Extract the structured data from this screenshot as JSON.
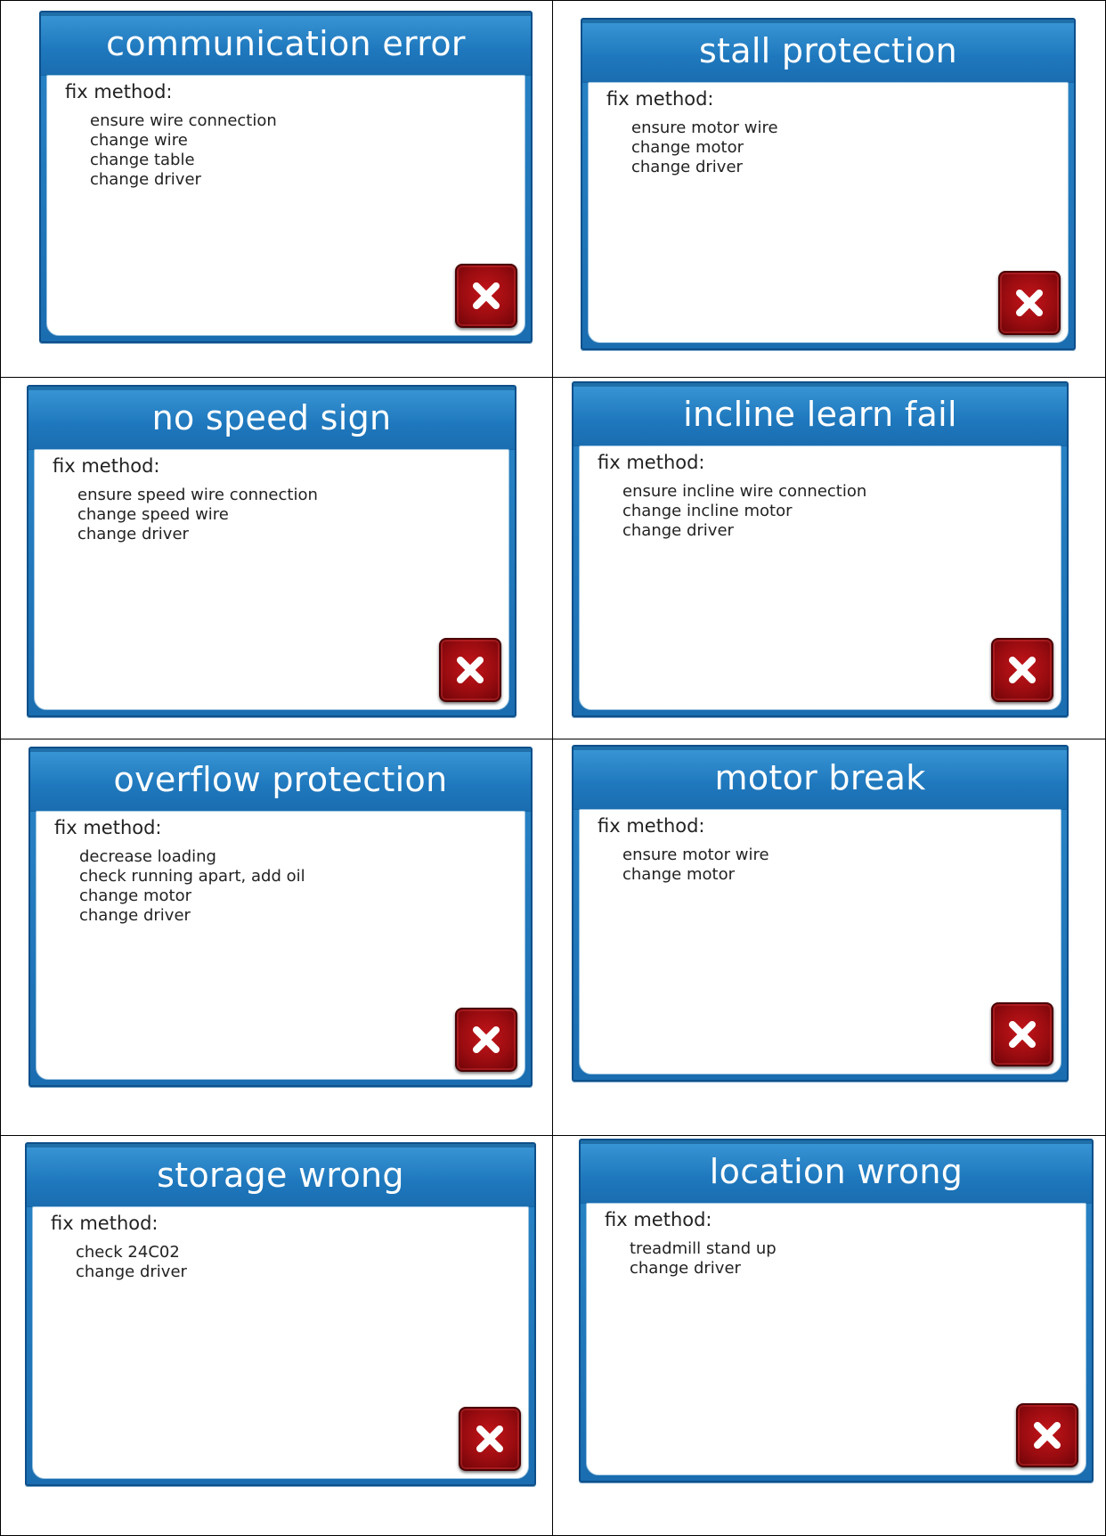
{
  "dialogs": [
    {
      "title": "communication error",
      "fix_label": "fix method:",
      "items": [
        "ensure wire connection",
        "change wire",
        "change table",
        "change driver"
      ]
    },
    {
      "title": "stall protection",
      "fix_label": "fix method:",
      "items": [
        "ensure motor wire",
        "change motor",
        "change driver"
      ]
    },
    {
      "title": "no speed sign",
      "fix_label": "fix method:",
      "items": [
        "ensure speed wire connection",
        "change speed wire",
        "change driver"
      ]
    },
    {
      "title": "incline learn fail",
      "fix_label": "fix method:",
      "items": [
        "ensure incline wire connection",
        "change incline motor",
        "change driver"
      ]
    },
    {
      "title": "overflow protection",
      "fix_label": "fix method:",
      "items": [
        "decrease loading",
        "check running apart, add oil",
        "change motor",
        "change driver"
      ]
    },
    {
      "title": "motor break",
      "fix_label": "fix method:",
      "items": [
        "ensure motor wire",
        "change motor"
      ]
    },
    {
      "title": "storage wrong",
      "fix_label": "fix method:",
      "items": [
        "check 24C02",
        "change driver"
      ]
    },
    {
      "title": "location wrong",
      "fix_label": "fix method:",
      "items": [
        "treadmill stand up",
        "change driver"
      ]
    }
  ],
  "close_icon": "close-x-icon",
  "colors": {
    "header_blue": "#1f78bd",
    "close_red": "#b0101a"
  }
}
